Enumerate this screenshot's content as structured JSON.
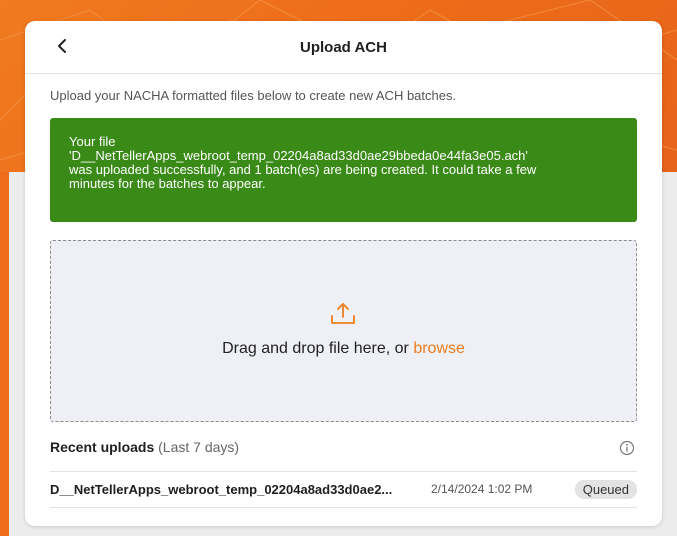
{
  "header": {
    "title": "Upload ACH",
    "back_icon": "chevron-left-icon"
  },
  "intro_text": "Upload your NACHA formatted files below to create new ACH batches.",
  "success_message": {
    "line1": "Your file",
    "line2": "'D__NetTellerApps_webroot_temp_02204a8ad33d0ae29bbeda0e44fa3e05.ach'",
    "line3": "was uploaded successfully, and 1 batch(es) are being created. It could take a few",
    "line4": "minutes for the batches to appear.",
    "color": "#3a8a17"
  },
  "dropzone": {
    "icon": "upload-icon",
    "text": "Drag and drop file here, or",
    "browse_label": "browse",
    "accent": "#ee7d1f"
  },
  "recent_uploads": {
    "title": "Recent uploads",
    "subtitle": "(Last 7 days)",
    "info_icon": "info-icon",
    "items": [
      {
        "filename": "D__NetTellerApps_webroot_temp_02204a8ad33d0ae2...",
        "date": "2/14/2024 1:02 PM",
        "status": "Queued"
      }
    ]
  }
}
